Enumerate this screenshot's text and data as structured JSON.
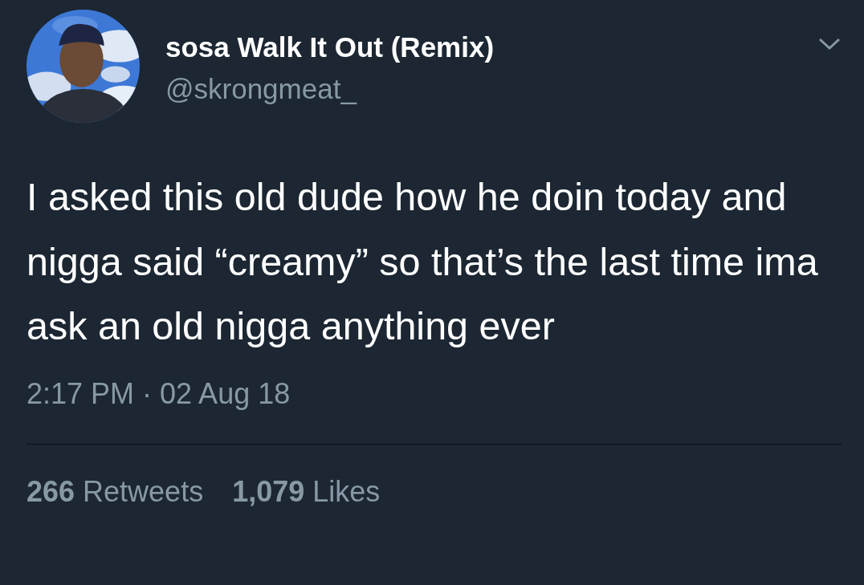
{
  "author": {
    "name": "sosa Walk It Out (Remix)",
    "handle": "@skrongmeat_"
  },
  "menu": {
    "kind": "chevron"
  },
  "tweet": {
    "text": "I asked this old dude how he doin today and nigga said “creamy” so that’s the last time ima ask an old nigga anything ever",
    "timestamp": "2:17 PM · 02 Aug 18"
  },
  "stats": [
    {
      "text": "**266** Retweets"
    },
    {
      "text": "**1,079** Likes"
    }
  ]
}
